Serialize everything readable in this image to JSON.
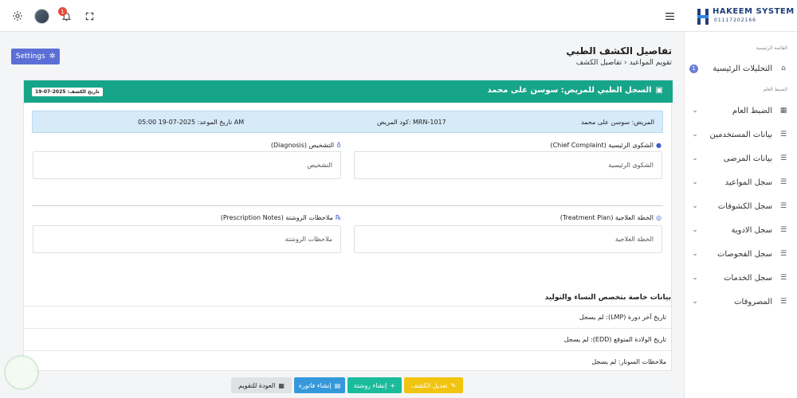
{
  "topbar": {
    "notifications_count": "1",
    "logo_title": "HAKEEM SYSTEM",
    "logo_subtitle": "01117202166"
  },
  "sidebar": {
    "section_main": "القائمة الرئيسية",
    "item_dashboard": "التحليلات الرئيسية",
    "item_dashboard_badge": "1",
    "section_general": "الضبط العام",
    "items": [
      {
        "label": "الضبط العام"
      },
      {
        "label": "بيانات المستخدمين"
      },
      {
        "label": "بيانات المرضى"
      },
      {
        "label": "سجل المواعيد"
      },
      {
        "label": "سجل الكشوفات"
      },
      {
        "label": "سجل الادوية"
      },
      {
        "label": "سجل الفحوصات"
      },
      {
        "label": "سجل الخدمات"
      },
      {
        "label": "المصروفات"
      }
    ]
  },
  "header": {
    "title": "تفاصيل الكشف الطبي",
    "breadcrumb_parent": "تقويم المواعيد",
    "breadcrumb_current": "تفاصيل الكشف",
    "settings_label": "Settings"
  },
  "card": {
    "title": "السجل الطبي للمريض: سوسن على محمد",
    "visit_date_badge": "تاريخ الكشف: 2025-07-19"
  },
  "info": {
    "patient": "المريض: سوسن على محمد",
    "patient_code": "كود المريض: MRN-1017",
    "appointment_date": "تاريخ الموعد: 2025-07-19 05:00 AM"
  },
  "fields": {
    "chief_complaint_label": "الشكوى الرئيسية (Chief Complaint)",
    "chief_complaint_value": "الشكوى الرئيسية",
    "diagnosis_label": "التشخيص (Diagnosis)",
    "diagnosis_value": "التشخيص",
    "treatment_plan_label": "الخطة العلاجية (Treatment Plan)",
    "treatment_plan_value": "الخطة العلاجية",
    "prescription_notes_label": "ملاحظات الروشتة (Prescription Notes)",
    "prescription_notes_value": "ملاحظات الروشتة"
  },
  "gyn": {
    "title": "بيانات خاصة بتخصص النساء والتوليد",
    "rows": [
      "تاريخ آخر دورة (LMP): لم يسجل",
      "تاريخ الولادة المتوقع (EDD): لم يسجل",
      "ملاحظات السونار: لم يسجل"
    ]
  },
  "actions": {
    "edit": "تعديل الكشف",
    "prescription": "إنشاء روشتة",
    "invoice": "إنشاء فاتورة",
    "back": "العودة للتقويم"
  },
  "colors": {
    "primary": "#17a589",
    "settings": "#5b6fd6",
    "edit": "#f1c40f",
    "prescription": "#1abc9c",
    "invoice": "#3498db"
  }
}
